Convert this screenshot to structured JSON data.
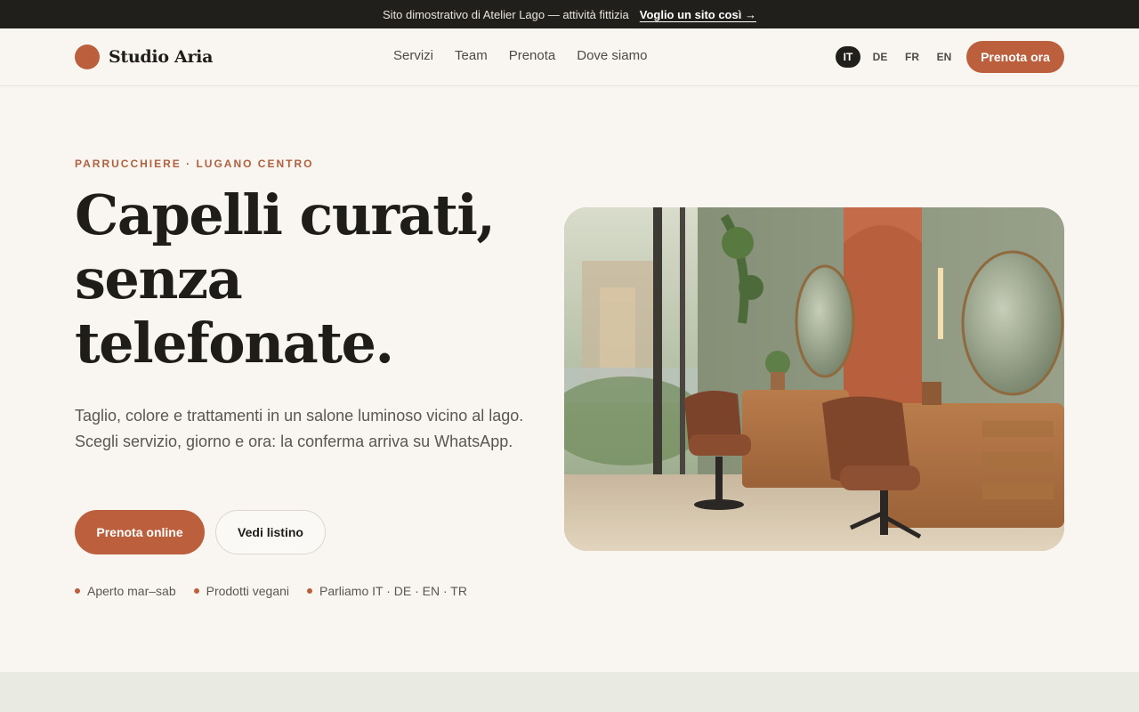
{
  "banner": {
    "text": "Sito dimostrativo di Atelier Lago — attività fittizia",
    "cta": "Voglio un sito così →"
  },
  "header": {
    "brand": "Studio Aria",
    "menu": [
      "Servizi",
      "Team",
      "Prenota",
      "Dove siamo"
    ],
    "languages": [
      "IT",
      "DE",
      "FR",
      "EN"
    ],
    "active_language": "IT",
    "cta": "Prenota ora"
  },
  "hero": {
    "kicker": "PARRUCCHIERE · LUGANO CENTRO",
    "headline": [
      "Capelli curati,",
      "senza",
      "telefonate."
    ],
    "lead": "Taglio, colore e trattamenti in un salone luminoso vicino al lago. Scegli servizio, giorno e ora: la conferma arriva su WhatsApp.",
    "primary_button": "Prenota online",
    "secondary_button": "Vedi listino",
    "features": [
      "Aperto mar–sab",
      "Prodotti vegani",
      "Parliamo IT · DE · EN · TR"
    ]
  },
  "colors": {
    "accent": "#bb5f3d",
    "dark": "#211f1c",
    "background": "#f9f6f1",
    "band": "#e9ebe3"
  }
}
